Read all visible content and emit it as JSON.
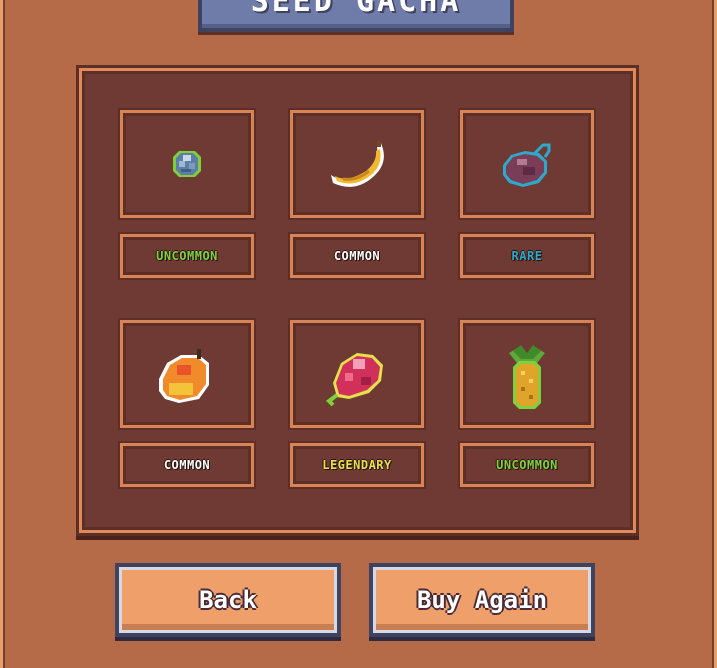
{
  "title": "SEED GACHA",
  "colors": {
    "uncommon": "#7fd13b",
    "common": "#ffffff",
    "rare": "#2ea9c9",
    "legendary": "#e6e04a"
  },
  "items": [
    {
      "icon": "blueberry-icon",
      "rarity": "UNCOMMON",
      "rarity_key": "uncommon"
    },
    {
      "icon": "banana-icon",
      "rarity": "COMMON",
      "rarity_key": "common"
    },
    {
      "icon": "plum-icon",
      "rarity": "RARE",
      "rarity_key": "rare"
    },
    {
      "icon": "mango-icon",
      "rarity": "COMMON",
      "rarity_key": "common"
    },
    {
      "icon": "raspberry-icon",
      "rarity": "LEGENDARY",
      "rarity_key": "legendary"
    },
    {
      "icon": "pineapple-icon",
      "rarity": "UNCOMMON",
      "rarity_key": "uncommon"
    }
  ],
  "buttons": {
    "back": "Back",
    "buy_again": "Buy Again"
  }
}
